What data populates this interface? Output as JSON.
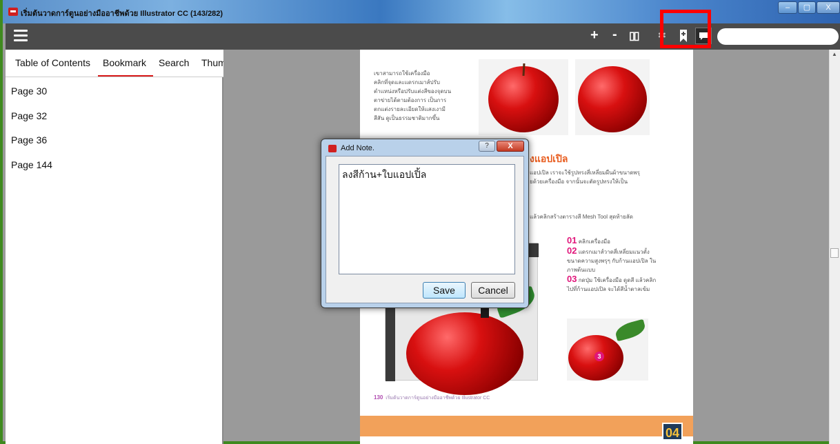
{
  "window": {
    "title": "เริ่มต้นวาดการ์ตูนอย่างมืออาชีพด้วย Illustrator CC (143/282)",
    "minimize": "–",
    "maximize": "▢",
    "close": "X"
  },
  "toolbar": {
    "zoom_in": "+",
    "zoom_out": "-",
    "double_page": "▯▯",
    "settings_icon": "✻",
    "bookmark_icon": "bookmark-icon",
    "note_icon": "note-icon",
    "search_placeholder": ""
  },
  "sidebar": {
    "tabs": [
      {
        "label": "Table of Contents"
      },
      {
        "label": "Bookmark"
      },
      {
        "label": "Search"
      },
      {
        "label": "Thum"
      }
    ],
    "active_tab": "Bookmark",
    "bookmarks": [
      {
        "label": "Page 30"
      },
      {
        "label": "Page 32"
      },
      {
        "label": "Page 36"
      },
      {
        "label": "Page 144"
      }
    ]
  },
  "page": {
    "intro": [
      "เขาสามารถใช้เครื่องมือ",
      "คลิกที่จุดและแดรกเมาส์ปรับ",
      "ตำแหน่งหรือปรับแต่งสีของจุดบน",
      "ตาข่ายได้ตามต้องการ เป็นการ",
      "ตกแต่งรายละเอียดให้แสงเงามี",
      "สีสัน ดูเป็นธรรมชาติมากขึ้น"
    ],
    "heading": "งแอปเปิล",
    "para1": [
      "แอปเปิล เราจะใช้รูปทรงสี่เหลี่ยมผืนผ้าขนาดพรุ",
      "ยด้วยเครื่องมือ      จากนั้นจะตัดรูปทรงให้เป็น"
    ],
    "para2": "แล้วคลิกสร้างตารางสี Mesh Tool สุดท้ายลัด",
    "steps": [
      {
        "num": "01",
        "text": "คลิกเครื่องมือ"
      },
      {
        "num": "02",
        "text": "แดรกเมาส์วาดสี่เหลี่ยมแนวตั้ง ขนาดความสูงพรุๆ กับก้านแอปเปิล ในภาพต้นแบบ"
      },
      {
        "num": "03",
        "text": "กดปุ่ม   ใช้เครื่องมือ ดูดสี แล้วคลิกไปที่ก้านแอปเปิล จะได้สีน้ำตาลเข้ม"
      }
    ],
    "step_badge": "3",
    "footer_num": "130",
    "footer_text": "เริ่มต้นวาดการ์ตูนอย่างมืออาชีพด้วย Illustrator CC",
    "chapter": "04"
  },
  "dialog": {
    "title": "Add Note.",
    "help": "?",
    "close": "X",
    "note_text": "ลงสีก้าน+ใบแอปเปิ้ล",
    "save_label": "Save",
    "cancel_label": "Cancel"
  },
  "colors": {
    "frame_border": "#3f8a1f",
    "toolbar_bg": "#4b4b4b",
    "tab_underline": "#d91a1a",
    "highlight_box": "#ff0000",
    "heading_orange": "#e85c1e",
    "step_magenta": "#e0157a"
  }
}
